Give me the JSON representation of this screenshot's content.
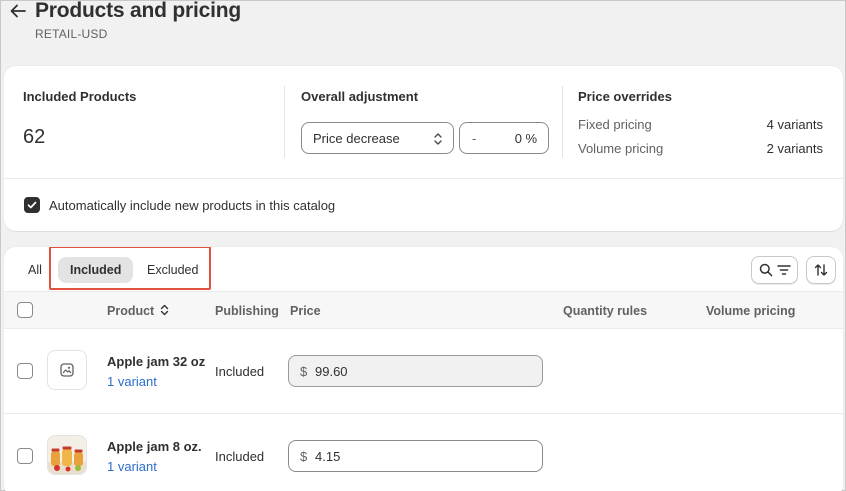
{
  "header": {
    "title": "Products and pricing",
    "subtitle": "RETAIL-USD"
  },
  "summary": {
    "included": {
      "title": "Included Products",
      "count": "62"
    },
    "adjustment": {
      "title": "Overall adjustment",
      "select_value": "Price decrease",
      "sign": "-",
      "value": "0",
      "unit": "%"
    },
    "overrides": {
      "title": "Price overrides",
      "rows": [
        {
          "label": "Fixed pricing",
          "value": "4 variants"
        },
        {
          "label": "Volume pricing",
          "value": "2 variants"
        }
      ]
    },
    "auto_include": {
      "label": "Automatically include new products in this catalog",
      "checked": true
    }
  },
  "products": {
    "tabs": [
      {
        "label": "All",
        "active": false
      },
      {
        "label": "Included",
        "active": true
      },
      {
        "label": "Excluded",
        "active": false
      }
    ],
    "columns": {
      "product": "Product",
      "publishing": "Publishing",
      "price": "Price",
      "quantity_rules": "Quantity rules",
      "volume_pricing": "Volume pricing"
    },
    "rows": [
      {
        "name": "Apple jam 32 oz",
        "variants": "1 variant",
        "publishing": "Included",
        "currency": "$",
        "price": "99.60",
        "thumbnail": "image-placeholder-icon"
      },
      {
        "name": "Apple jam 8 oz.",
        "variants": "1 variant",
        "publishing": "Included",
        "currency": "$",
        "price": "4.15",
        "thumbnail": "product-photo"
      }
    ]
  },
  "colors": {
    "highlight": "#e0523f",
    "link": "#2c6ecb",
    "background": "#f1f1f1"
  }
}
